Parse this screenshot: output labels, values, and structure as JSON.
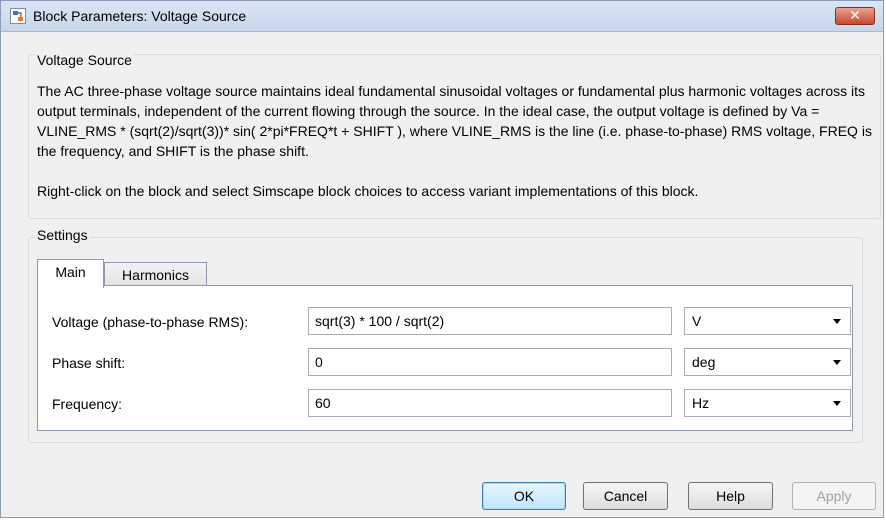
{
  "window": {
    "title": "Block Parameters: Voltage Source",
    "close_glyph": "✕"
  },
  "block_group": {
    "label": "Voltage Source",
    "description": [
      "The AC three-phase voltage source maintains ideal fundamental sinusoidal voltages or fundamental plus harmonic voltages across its output terminals, independent of the current flowing through the source. In the ideal case, the output voltage is defined by Va = VLINE_RMS * (sqrt(2)/sqrt(3))* sin( 2*pi*FREQ*t + SHIFT ), where VLINE_RMS is the line (i.e. phase-to-phase) RMS voltage, FREQ is the frequency, and SHIFT is the phase shift.",
      "Right-click on the block and select Simscape block choices to access variant implementations of this block."
    ]
  },
  "settings": {
    "label": "Settings",
    "tabs": [
      {
        "label": "Main",
        "active": true
      },
      {
        "label": "Harmonics",
        "active": false
      }
    ],
    "params": [
      {
        "label": "Voltage (phase-to-phase RMS):",
        "value": "sqrt(3) * 100 / sqrt(2)",
        "unit": "V"
      },
      {
        "label": "Phase shift:",
        "value": "0",
        "unit": "deg"
      },
      {
        "label": "Frequency:",
        "value": "60",
        "unit": "Hz"
      }
    ]
  },
  "buttons": {
    "ok": "OK",
    "cancel": "Cancel",
    "help": "Help",
    "apply": "Apply"
  }
}
